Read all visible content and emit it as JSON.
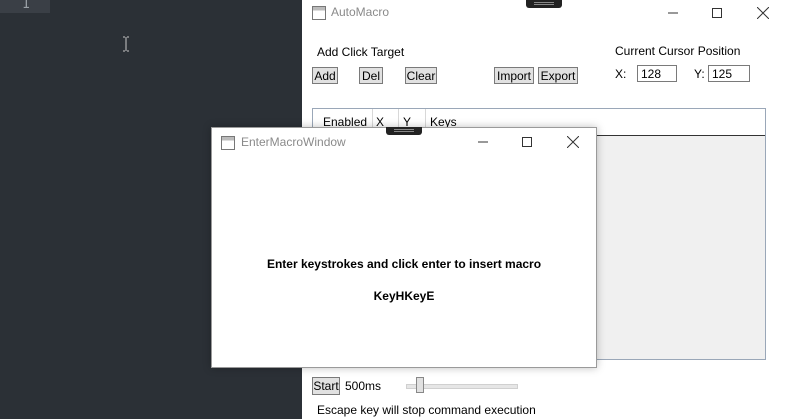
{
  "editor": {
    "line_number": "1"
  },
  "app": {
    "title": "AutoMacro",
    "add_click_target_label": "Add Click Target",
    "buttons": {
      "add": "Add",
      "del": "Del",
      "clear": "Clear",
      "import": "Import",
      "export": "Export",
      "start": "Start"
    },
    "cursor": {
      "label": "Current Cursor Position",
      "x_label": "X:",
      "x_value": "128",
      "y_label": "Y:",
      "y_value": "125"
    },
    "grid": {
      "columns": [
        "Enabled",
        "X",
        "Y",
        "Keys"
      ]
    },
    "interval_label": "500ms",
    "interval_slider_level": 0.1,
    "footer_note": "Escape key will stop command execution"
  },
  "dialog": {
    "title": "EnterMacroWindow",
    "message": "Enter keystrokes and click enter to insert macro",
    "keys": "KeyHKeyE"
  },
  "icons": {
    "window_icon": "window-icon",
    "minimize": "minimize-icon",
    "maximize": "maximize-icon",
    "close": "close-icon",
    "text_cursor": "text-cursor-icon"
  }
}
